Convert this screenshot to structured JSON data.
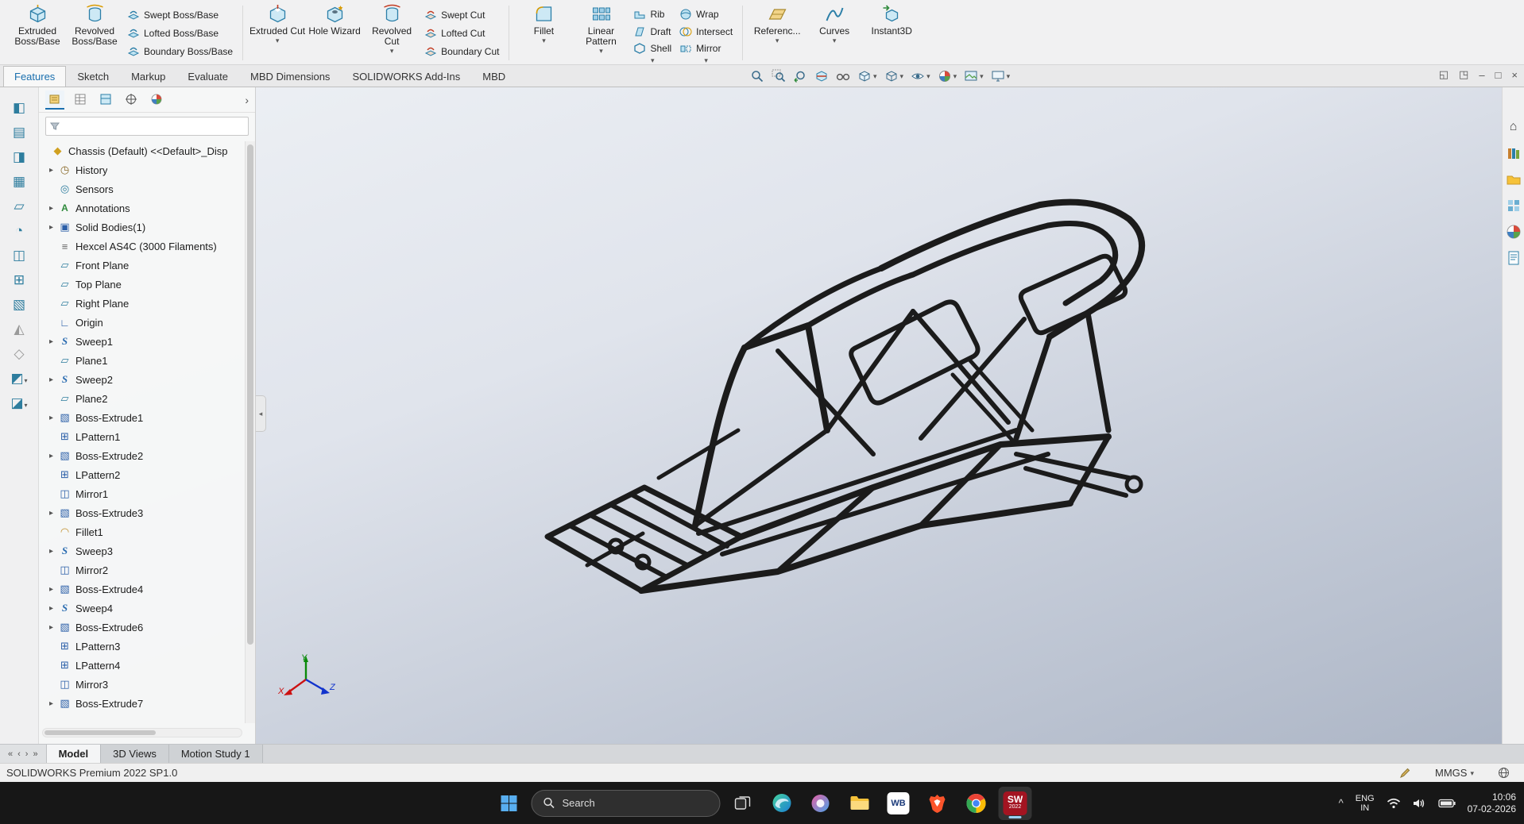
{
  "colors": {
    "accent": "#1a6fae",
    "solidworks_red": "#a31421",
    "viewport_top": "#eef1f5",
    "viewport_bottom": "#adb6c6"
  },
  "ribbon": {
    "large": [
      "Extruded Boss/Base",
      "Revolved Boss/Base",
      "Extruded Cut",
      "Hole Wizard",
      "Revolved Cut",
      "Fillet",
      "Linear Pattern",
      "Referenc...",
      "Curves",
      "Instant3D"
    ],
    "small": [
      "Swept Boss/Base",
      "Lofted Boss/Base",
      "Boundary Boss/Base",
      "Swept Cut",
      "Lofted Cut",
      "Boundary Cut",
      "Rib",
      "Draft",
      "Shell",
      "Wrap",
      "Intersect",
      "Mirror"
    ]
  },
  "tabs": [
    "Features",
    "Sketch",
    "Markup",
    "Evaluate",
    "MBD Dimensions",
    "SOLIDWORKS Add-Ins",
    "MBD"
  ],
  "tree": {
    "root": "Chassis (Default) <<Default>_Disp",
    "items": [
      "History",
      "Sensors",
      "Annotations",
      "Solid Bodies(1)",
      "Hexcel AS4C (3000 Filaments)",
      "Front Plane",
      "Top Plane",
      "Right Plane",
      "Origin",
      "Sweep1",
      "Plane1",
      "Sweep2",
      "Plane2",
      "Boss-Extrude1",
      "LPattern1",
      "Boss-Extrude2",
      "LPattern2",
      "Mirror1",
      "Boss-Extrude3",
      "Fillet1",
      "Sweep3",
      "Mirror2",
      "Boss-Extrude4",
      "Sweep4",
      "Boss-Extrude6",
      "LPattern3",
      "LPattern4",
      "Mirror3",
      "Boss-Extrude7"
    ]
  },
  "viewport": {
    "triad": {
      "x": "X",
      "y": "Y",
      "z": "Z"
    }
  },
  "bottom_tabs": [
    "Model",
    "3D Views",
    "Motion Study 1"
  ],
  "status": {
    "product": "SOLIDWORKS Premium 2022 SP1.0",
    "units": "MMGS"
  },
  "taskbar": {
    "search": "Search",
    "apps": {
      "wb": "WB",
      "sw": "SW",
      "sw_year": "2022"
    },
    "tray": {
      "lang_top": "ENG",
      "lang_bottom": "IN",
      "time": "10:06",
      "date": "07-02-2026"
    }
  }
}
